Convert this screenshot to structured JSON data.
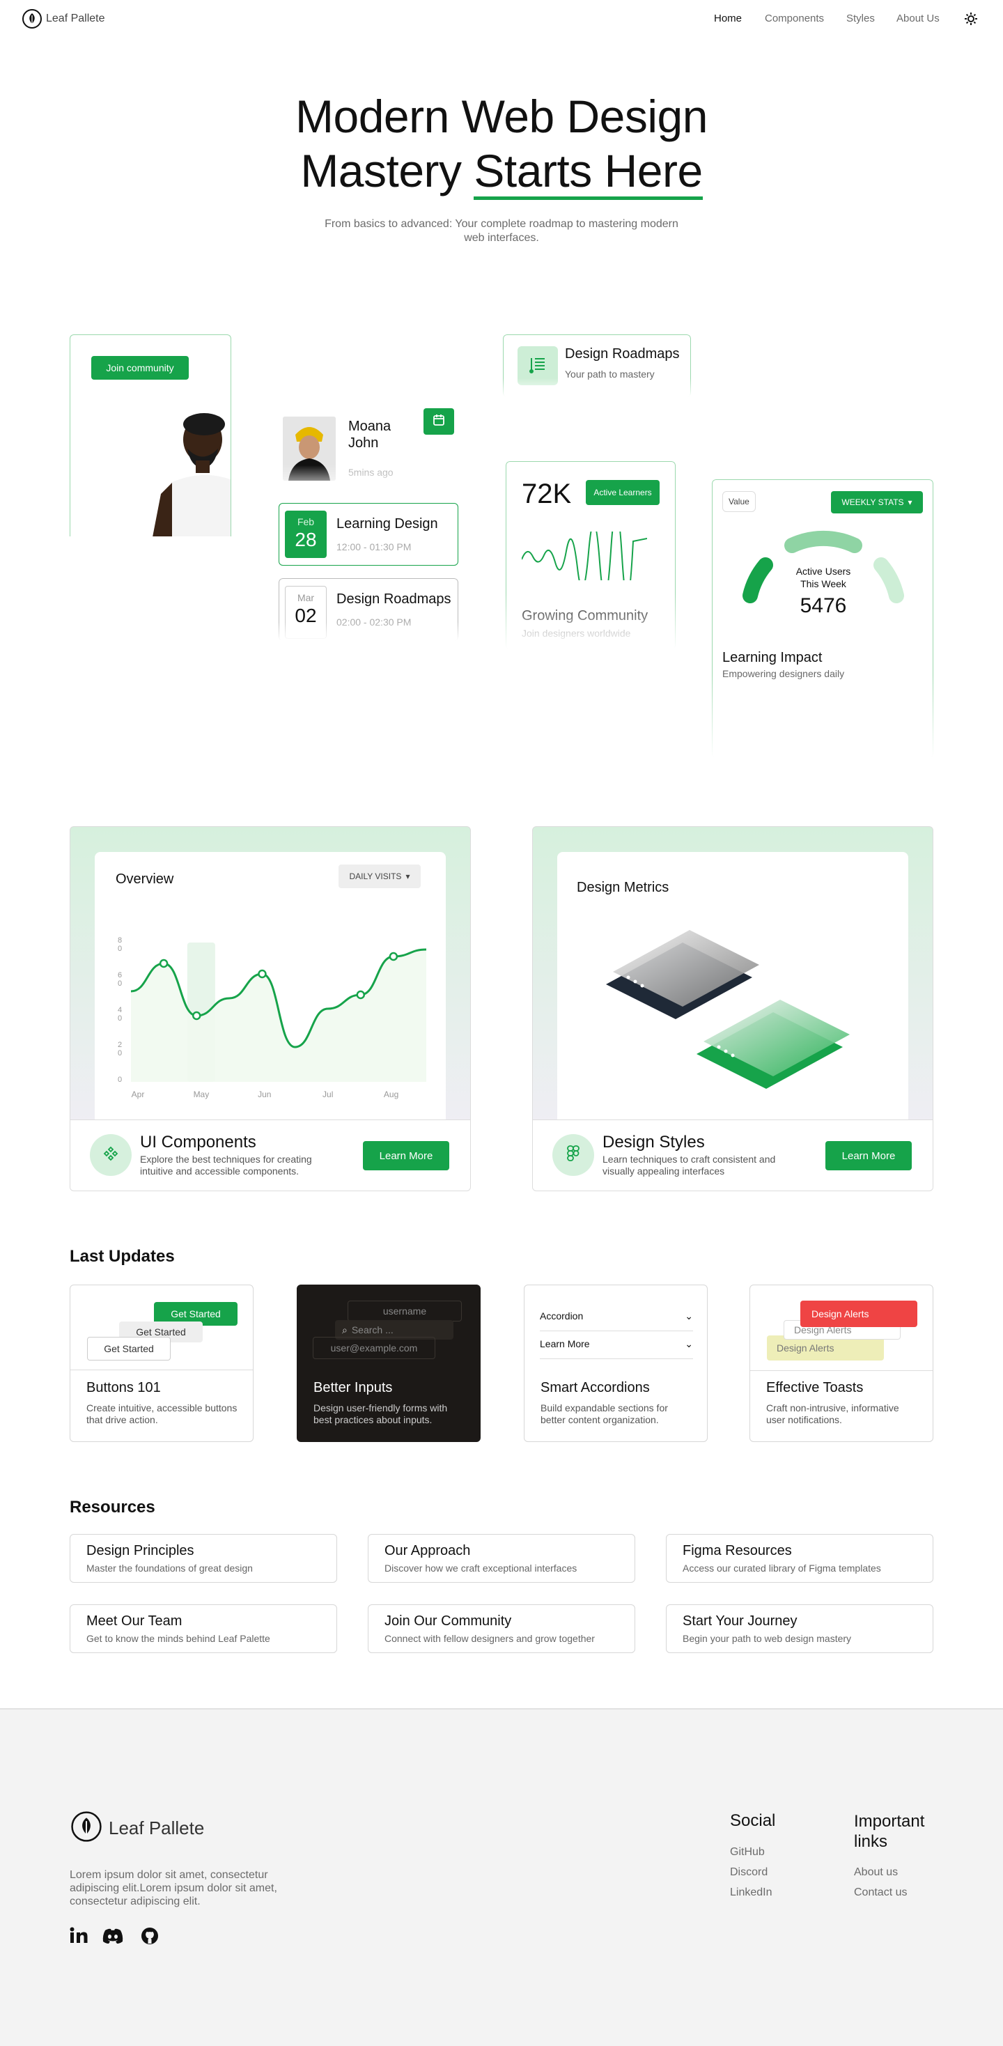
{
  "nav": {
    "brand": "Leaf Pallete",
    "links": [
      "Home",
      "Components",
      "Styles",
      "About Us"
    ]
  },
  "hero": {
    "title_line1": "Modern Web Design",
    "title_line2a": "Mastery ",
    "title_line2b": "Starts Here",
    "subtitle": "From basics to advanced: Your complete roadmap to mastering modern web interfaces."
  },
  "showcase": {
    "join_button": "Join community",
    "profile_name": "Moana John",
    "profile_time": "5mins ago",
    "events": [
      {
        "month": "Feb",
        "day": "28",
        "title": "Learning Design",
        "time": "12:00 - 01:30 PM"
      },
      {
        "month": "Mar",
        "day": "02",
        "title": "Design Roadmaps",
        "time": "02:00 - 02:30 PM"
      }
    ],
    "roadmap_title": "Design Roadmaps",
    "roadmap_sub": "Your path to mastery",
    "learners_count": "72K",
    "learners_badge": "Active Learners",
    "community_title": "Growing Community",
    "community_sub": "Join designers worldwide",
    "stats_value_label": "Value",
    "stats_dropdown": "WEEKLY STATS",
    "active_users_label": "Active Users This Week",
    "active_users_value": "5476",
    "impact_title": "Learning Impact",
    "impact_sub": "Empowering designers daily"
  },
  "features": [
    {
      "panel_title": "Overview",
      "dropdown": "DAILY VISITS",
      "title": "UI Components",
      "desc": "Explore the best techniques for creating intuitive and accessible components.",
      "button": "Learn More"
    },
    {
      "panel_title": "Design Metrics",
      "title": "Design Styles",
      "desc": "Learn techniques to craft consistent and visually appealing interfaces",
      "button": "Learn More"
    }
  ],
  "chart_data": {
    "type": "line",
    "categories": [
      "Apr",
      "May",
      "Jun",
      "Jul",
      "Aug"
    ],
    "ytick_labels": [
      "8\n0",
      "6\n0",
      "4\n0",
      "2\n0",
      "0"
    ],
    "ylim": [
      0,
      80
    ],
    "values": [
      52,
      68,
      38,
      48,
      62,
      20,
      42,
      50,
      72,
      76
    ],
    "highlight": "May"
  },
  "updates_heading": "Last Updates",
  "updates": [
    {
      "title": "Buttons 101",
      "desc": "Create intuitive, accessible buttons that drive action.",
      "demo": [
        "Get Started",
        "Get Started",
        "Get Started"
      ]
    },
    {
      "title": "Better Inputs",
      "desc": "Design user-friendly forms with best practices about inputs.",
      "demo": [
        "username",
        "Search ...",
        "user@example.com"
      ]
    },
    {
      "title": "Smart Accordions",
      "desc": "Build expandable sections for better content organization.",
      "demo": [
        "Accordion",
        "Learn More"
      ]
    },
    {
      "title": "Effective Toasts",
      "desc": "Craft non-intrusive, informative user notifications.",
      "demo": [
        "Design Alerts",
        "Design Alerts",
        "Design Alerts"
      ]
    }
  ],
  "resources_heading": "Resources",
  "resources": [
    {
      "title": "Design Principles",
      "desc": "Master the foundations of great design"
    },
    {
      "title": "Our Approach",
      "desc": "Discover how we craft exceptional interfaces"
    },
    {
      "title": "Figma Resources",
      "desc": "Access our curated library of Figma templates"
    },
    {
      "title": "Meet Our Team",
      "desc": "Get to know the minds behind Leaf Palette"
    },
    {
      "title": "Join Our Community",
      "desc": "Connect with fellow designers and grow together"
    },
    {
      "title": "Start Your Journey",
      "desc": "Begin your path to web design mastery"
    }
  ],
  "footer": {
    "brand": "Leaf Pallete",
    "about": "Lorem ipsum dolor sit amet, consectetur adipiscing elit.Lorem ipsum dolor sit amet, consectetur adipiscing elit.",
    "social_heading": "Social",
    "social_links": [
      "GitHub",
      "Discord",
      "LinkedIn"
    ],
    "links_heading": "Important links",
    "important_links": [
      "About us",
      "Contact us"
    ]
  },
  "colors": {
    "accent": "#16a34a",
    "accent_light": "#d8f0de",
    "danger": "#ef4444"
  }
}
